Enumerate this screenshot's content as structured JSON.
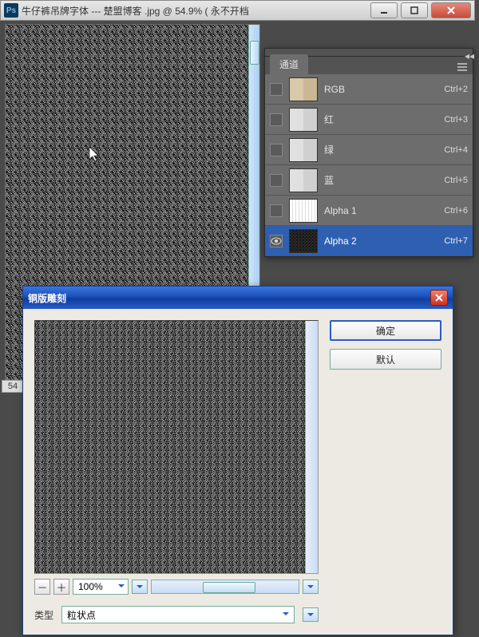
{
  "window": {
    "title": "牛仔裤吊牌字体 --- 楚盟博客 .jpg @ 54.9% ( 永不开档",
    "zoom_short": "54"
  },
  "controls": {
    "minimize": "─",
    "maximize": "□",
    "close": "✕"
  },
  "channels": {
    "tab": "通道",
    "items": [
      {
        "name": "RGB",
        "shortcut": "Ctrl+2",
        "thumb": "rgb"
      },
      {
        "name": "红",
        "shortcut": "Ctrl+3",
        "thumb": "mono"
      },
      {
        "name": "绿",
        "shortcut": "Ctrl+4",
        "thumb": "mono"
      },
      {
        "name": "蓝",
        "shortcut": "Ctrl+5",
        "thumb": "mono"
      },
      {
        "name": "Alpha 1",
        "shortcut": "Ctrl+6",
        "thumb": "alpha1"
      },
      {
        "name": "Alpha 2",
        "shortcut": "Ctrl+7",
        "thumb": "alpha2",
        "selected": true,
        "visible": true
      }
    ]
  },
  "dialog": {
    "title": "铜版雕刻",
    "ok": "确定",
    "cancel": "默认",
    "zoom_minus": "－",
    "zoom_plus": "＋",
    "zoom_value": "100%",
    "type_label": "类型",
    "type_value": "粒状点",
    "close": "✕"
  },
  "colors": {
    "accent": "#2f5fb0",
    "titlebar0": "#3a76e0",
    "titlebar1": "#0f3ea0",
    "panel_bg": "#6d6d6d"
  }
}
